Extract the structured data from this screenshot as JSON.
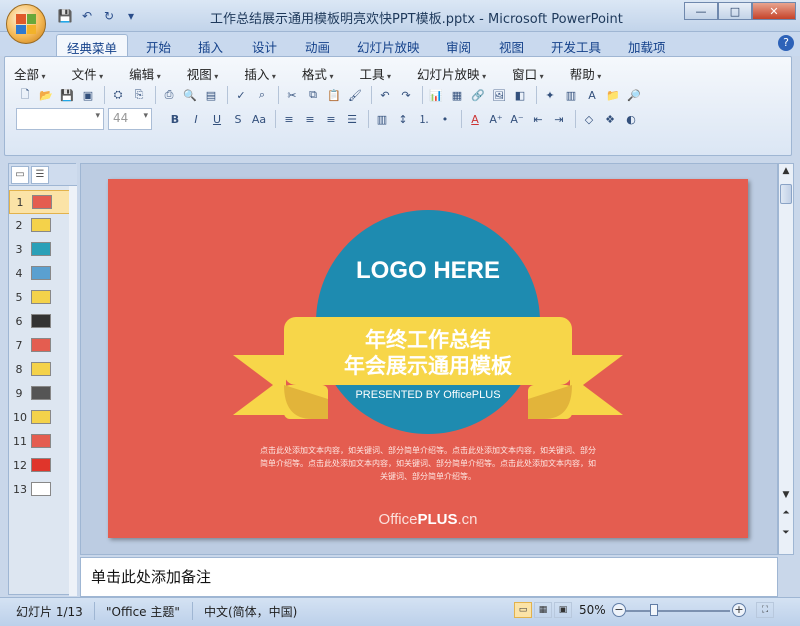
{
  "window": {
    "title": "工作总结展示通用模板明亮欢快PPT模板.pptx - Microsoft PowerPoint",
    "minimize": "—",
    "maximize": "□",
    "close": "✕"
  },
  "qat_icons": [
    "save-icon",
    "undo-icon",
    "redo-icon",
    "customize-icon"
  ],
  "ribbon_tabs": [
    "经典菜单",
    "开始",
    "插入",
    "设计",
    "动画",
    "幻灯片放映",
    "审阅",
    "视图",
    "开发工具",
    "加载项"
  ],
  "active_tab": "经典菜单",
  "classic_menus": [
    "全部",
    "文件",
    "编辑",
    "视图",
    "插入",
    "格式",
    "工具",
    "幻灯片放映",
    "窗口",
    "帮助"
  ],
  "font_size_value": "44",
  "thumbnails": [
    {
      "num": "1",
      "color": "#e45d50"
    },
    {
      "num": "2",
      "color": "#f4d24a"
    },
    {
      "num": "3",
      "color": "#2aa0b8"
    },
    {
      "num": "4",
      "color": "#5aa0d0"
    },
    {
      "num": "5",
      "color": "#f4d24a"
    },
    {
      "num": "6",
      "color": "#333333"
    },
    {
      "num": "7",
      "color": "#e45d50"
    },
    {
      "num": "8",
      "color": "#f4d24a"
    },
    {
      "num": "9",
      "color": "#555555"
    },
    {
      "num": "10",
      "color": "#f4d24a"
    },
    {
      "num": "11",
      "color": "#e45d50"
    },
    {
      "num": "12",
      "color": "#e0352b"
    },
    {
      "num": "13",
      "color": "#ffffff"
    }
  ],
  "slide": {
    "logo": "LOGO HERE",
    "title_line1": "年终工作总结",
    "title_line2": "年会展示通用模板",
    "presented_by": "PRESENTED BY OfficePLUS",
    "body_line1": "点击此处添加文本内容，如关键词、部分简单介绍等。点击此处添加文本内容，如关键词、部分",
    "body_line2": "简单介绍等。点击此处添加文本内容，如关键词、部分简单介绍等。点击此处添加文本内容，如",
    "body_line3": "关键词、部分简单介绍等。",
    "brand_a": "Office",
    "brand_b": "PLUS",
    "brand_c": ".cn",
    "colors": {
      "background": "#e45d50",
      "circle": "#1e8bb0",
      "ribbon": "#f7d649",
      "ribbon_dark": "#d8a72e"
    }
  },
  "notes_placeholder": "单击此处添加备注",
  "status": {
    "slide_info": "幻灯片 1/13",
    "theme": "\"Office 主题\"",
    "language": "中文(简体，中国)",
    "zoom": "50%"
  }
}
